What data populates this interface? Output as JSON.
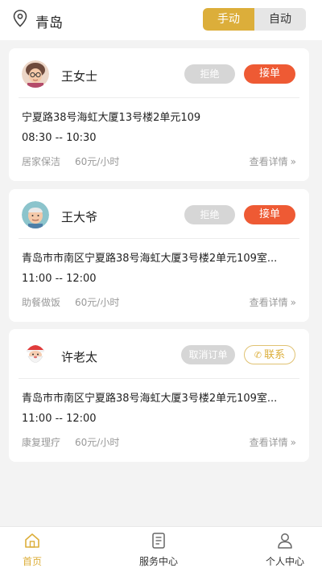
{
  "header": {
    "location_icon": "location-pin-icon",
    "city": "青岛",
    "mode_manual": "手动",
    "mode_auto": "自动"
  },
  "orders": [
    {
      "avatar": "elderly-woman-avatar",
      "name": "王女士",
      "btn1": "拒绝",
      "btn2": "接单",
      "address": "宁夏路38号海虹大厦13号楼2单元109",
      "time": "08:30 -- 10:30",
      "service": "居家保洁",
      "price": "60元/小时",
      "detail": "查看详情"
    },
    {
      "avatar": "elderly-man-avatar",
      "name": "王大爷",
      "btn1": "拒绝",
      "btn2": "接单",
      "address": "青岛市市南区宁夏路38号海虹大厦3号楼2单元109室...",
      "time": "11:00 -- 12:00",
      "service": "助餐做饭",
      "price": "60元/小时",
      "detail": "查看详情"
    },
    {
      "avatar": "santa-avatar",
      "name": "许老太",
      "btn1": "取消订单",
      "btn2": "联系",
      "address": "青岛市市南区宁夏路38号海虹大厦3号楼2单元109室...",
      "time": "11:00 -- 12:00",
      "service": "康复理疗",
      "price": "60元/小时",
      "detail": "查看详情"
    }
  ],
  "nav": {
    "home": "首页",
    "service": "服务中心",
    "profile": "个人中心"
  },
  "colors": {
    "accent": "#dcae3a",
    "accept": "#ee5a34",
    "disabled": "#d6d6d6"
  }
}
